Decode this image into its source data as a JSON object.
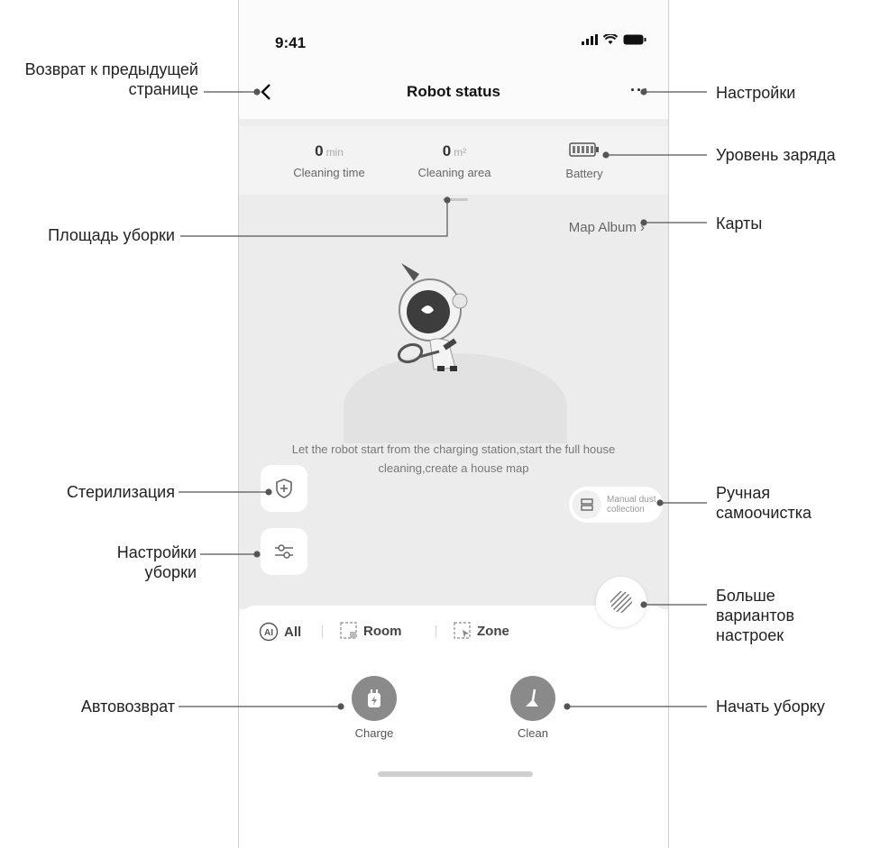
{
  "status_bar": {
    "time": "9:41"
  },
  "nav": {
    "title": "Robot status",
    "more": "···"
  },
  "stats": {
    "cleaning_time": {
      "value": "0",
      "unit": "min",
      "label": "Cleaning time"
    },
    "cleaning_area": {
      "value": "0",
      "unit": "m²",
      "label": "Cleaning area"
    },
    "battery": {
      "label": "Battery"
    }
  },
  "map_album": "Map Album ›",
  "hint": "Let the robot start from the charging station,start the full house cleaning,create a house map",
  "dust": {
    "label": "Manual dust collection"
  },
  "modes": [
    {
      "label": "All",
      "icon": "ai-icon"
    },
    {
      "label": "Room",
      "icon": "room-icon"
    },
    {
      "label": "Zone",
      "icon": "zone-icon"
    }
  ],
  "actions": {
    "charge": "Charge",
    "clean": "Clean"
  },
  "annotations": {
    "back": "Возврат к предыдущей странице",
    "settings": "Настройки",
    "battery": "Уровень заряда",
    "area": "Площадь уборки",
    "maps": "Карты",
    "sterilization": "Стерилизация",
    "manual_dust": "Ручная самоочистка",
    "cleaning_settings": "Настройки уборки",
    "more_options": "Больше вариантов настроек",
    "auto_return": "Автовозврат",
    "start_cleaning": "Начать уборку"
  }
}
